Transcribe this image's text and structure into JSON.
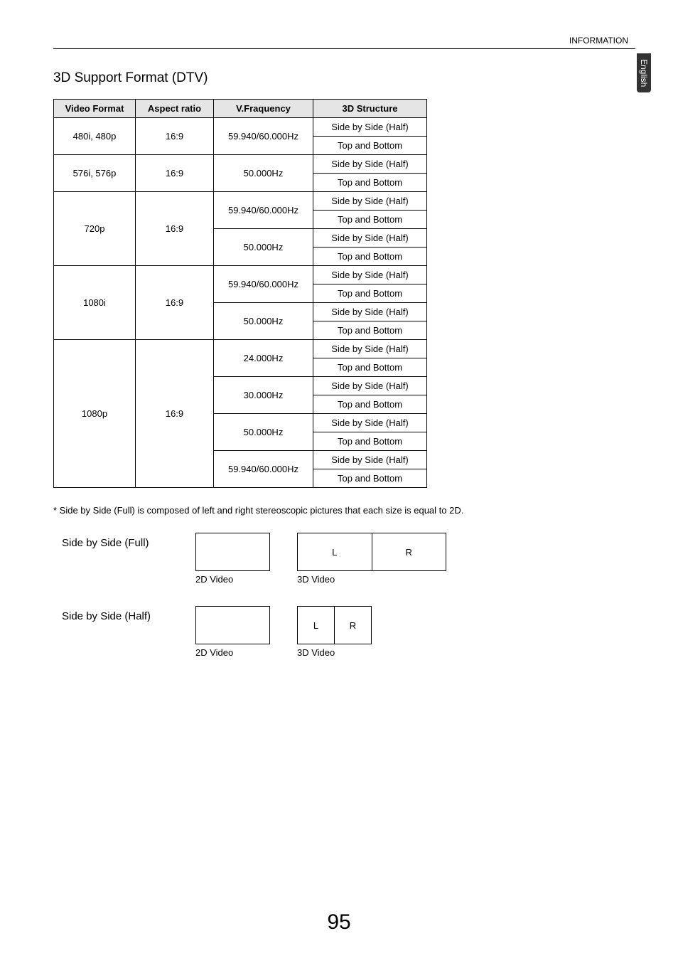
{
  "header": {
    "topRight": "INFORMATION",
    "languageTab": "English"
  },
  "section": {
    "title": "3D Support Format (DTV)"
  },
  "table": {
    "headers": [
      "Video Format",
      "Aspect ratio",
      "V.Fraquency",
      "3D Structure"
    ],
    "rows": [
      {
        "vf": "480i, 480p",
        "ar": "16:9",
        "freq": "59.940/60.000Hz",
        "struct": "Side by Side (Half)",
        "vf_span": 2,
        "ar_span": 2,
        "freq_span": 2
      },
      {
        "struct": "Top and Bottom"
      },
      {
        "vf": "576i, 576p",
        "ar": "16:9",
        "freq": "50.000Hz",
        "struct": "Side by Side (Half)",
        "vf_span": 2,
        "ar_span": 2,
        "freq_span": 2
      },
      {
        "struct": "Top and Bottom"
      },
      {
        "vf": "720p",
        "ar": "16:9",
        "freq": "59.940/60.000Hz",
        "struct": "Side by Side (Half)",
        "vf_span": 4,
        "ar_span": 4,
        "freq_span": 2
      },
      {
        "struct": "Top and Bottom"
      },
      {
        "freq": "50.000Hz",
        "struct": "Side by Side (Half)",
        "freq_span": 2
      },
      {
        "struct": "Top and Bottom"
      },
      {
        "vf": "1080i",
        "ar": "16:9",
        "freq": "59.940/60.000Hz",
        "struct": "Side by Side (Half)",
        "vf_span": 4,
        "ar_span": 4,
        "freq_span": 2
      },
      {
        "struct": "Top and Bottom"
      },
      {
        "freq": "50.000Hz",
        "struct": "Side by Side (Half)",
        "freq_span": 2
      },
      {
        "struct": "Top and Bottom"
      },
      {
        "vf": "1080p",
        "ar": "16:9",
        "freq": "24.000Hz",
        "struct": "Side by Side (Half)",
        "vf_span": 8,
        "ar_span": 8,
        "freq_span": 2
      },
      {
        "struct": "Top and Bottom"
      },
      {
        "freq": "30.000Hz",
        "struct": "Side by Side (Half)",
        "freq_span": 2
      },
      {
        "struct": "Top and Bottom"
      },
      {
        "freq": "50.000Hz",
        "struct": "Side by Side (Half)",
        "freq_span": 2
      },
      {
        "struct": "Top and Bottom"
      },
      {
        "freq": "59.940/60.000Hz",
        "struct": "Side by Side (Half)",
        "freq_span": 2
      },
      {
        "struct": "Top and Bottom"
      }
    ]
  },
  "footnote": "*  Side by Side (Full) is composed of left and right stereoscopic pictures that each size is equal to 2D.",
  "diagrams": {
    "full": {
      "label": "Side by Side (Full)",
      "caption2d": "2D Video",
      "caption3d": "3D Video",
      "l": "L",
      "r": "R"
    },
    "half": {
      "label": "Side by Side (Half)",
      "caption2d": "2D Video",
      "caption3d": "3D Video",
      "l": "L",
      "r": "R"
    }
  },
  "pageNumber": "95"
}
